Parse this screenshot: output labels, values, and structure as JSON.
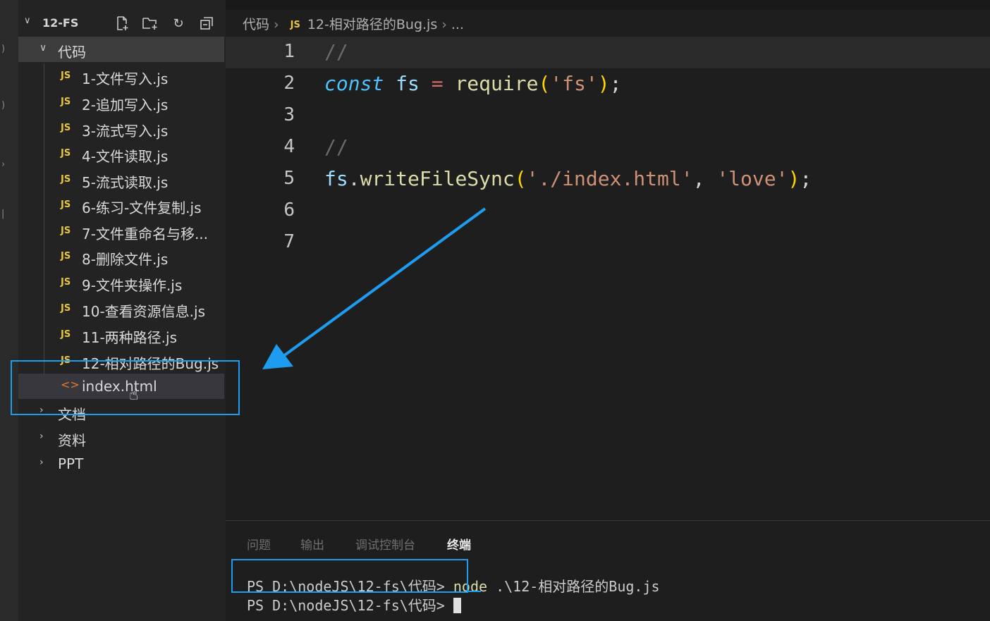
{
  "explorer": {
    "root_label": "12-FS",
    "folder_code": "代码",
    "files": [
      {
        "name": "1-文件写入.js"
      },
      {
        "name": "2-追加写入.js"
      },
      {
        "name": "3-流式写入.js"
      },
      {
        "name": "4-文件读取.js"
      },
      {
        "name": "5-流式读取.js"
      },
      {
        "name": "6-练习-文件复制.js"
      },
      {
        "name": "7-文件重命名与移..."
      },
      {
        "name": "8-删除文件.js"
      },
      {
        "name": "9-文件夹操作.js"
      },
      {
        "name": "10-查看资源信息.js"
      },
      {
        "name": "11-两种路径.js"
      },
      {
        "name": "12-相对路径的Bug.js"
      }
    ],
    "file_icon_label": "JS",
    "selected_file": "index.html",
    "other_folders": [
      "文档",
      "资料",
      "PPT"
    ]
  },
  "breadcrumb": {
    "folder": "代码",
    "file_icon": "JS",
    "file": "12-相对路径的Bug.js",
    "more": "..."
  },
  "editor": {
    "line_numbers": [
      "1",
      "2",
      "3",
      "4",
      "5",
      "6",
      "7"
    ],
    "line1_comment": "//",
    "line2": {
      "kw": "const",
      "var": "fs",
      "op": "=",
      "fn": "require",
      "lparen": "(",
      "str": "'fs'",
      "rparen": ")",
      "semi": ";"
    },
    "line4_comment": "//",
    "line5": {
      "obj": "fs",
      "dot": ".",
      "fn": "writeFileSync",
      "lparen": "(",
      "arg1": "'./index.html'",
      "comma": ", ",
      "arg2": "'love'",
      "rparen": ")",
      "semi": ";"
    }
  },
  "panel": {
    "tabs": [
      "问题",
      "输出",
      "调试控制台",
      "终端"
    ],
    "active_tab": "终端",
    "terminal_lines": [
      {
        "prompt": "PS D:\\nodeJS\\12-fs\\代码> ",
        "cmd": "node",
        "args": " .\\12-相对路径的Bug.js"
      },
      {
        "prompt": "PS D:\\nodeJS\\12-fs\\代码> "
      }
    ]
  },
  "colors": {
    "highlight_box": "#1e9df0",
    "arrow": "#1e9df0",
    "js_icon": "#e8c543",
    "html_icon": "#e37933"
  }
}
